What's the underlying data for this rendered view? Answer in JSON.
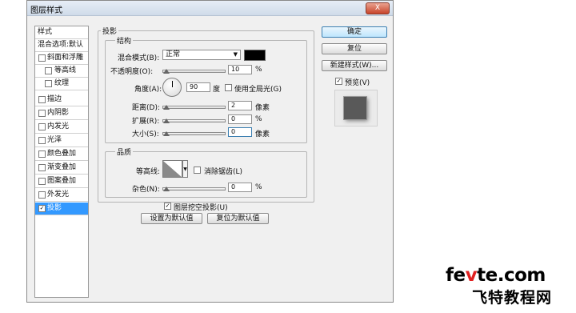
{
  "window": {
    "title": "图层样式",
    "close_label": "X"
  },
  "sidebar": {
    "items": [
      {
        "label": "样式",
        "checkbox": false,
        "checked": false
      },
      {
        "label": "混合选项:默认",
        "checkbox": false,
        "checked": false
      },
      {
        "label": "斜面和浮雕",
        "checkbox": true,
        "checked": false
      },
      {
        "label": "等高线",
        "checkbox": true,
        "checked": false,
        "indent": true
      },
      {
        "label": "纹理",
        "checkbox": true,
        "checked": false,
        "indent": true
      },
      {
        "label": "描边",
        "checkbox": true,
        "checked": false
      },
      {
        "label": "内阴影",
        "checkbox": true,
        "checked": false
      },
      {
        "label": "内发光",
        "checkbox": true,
        "checked": false
      },
      {
        "label": "光泽",
        "checkbox": true,
        "checked": false
      },
      {
        "label": "颜色叠加",
        "checkbox": true,
        "checked": false
      },
      {
        "label": "渐变叠加",
        "checkbox": true,
        "checked": false
      },
      {
        "label": "图案叠加",
        "checkbox": true,
        "checked": false
      },
      {
        "label": "外发光",
        "checkbox": true,
        "checked": false
      },
      {
        "label": "投影",
        "checkbox": true,
        "checked": true,
        "selected": true
      }
    ]
  },
  "panel": {
    "title": "投影",
    "structure": {
      "title": "结构",
      "blend_mode_label": "混合模式(B):",
      "blend_mode_value": "正常",
      "blend_color": "#000000",
      "opacity_label": "不透明度(O):",
      "opacity_value": "10",
      "opacity_unit": "%",
      "angle_label": "角度(A):",
      "angle_value": "90",
      "angle_unit": "度",
      "global_light_label": "使用全局光(G)",
      "global_light_checked": false,
      "distance_label": "距离(D):",
      "distance_value": "2",
      "distance_unit": "像素",
      "spread_label": "扩展(R):",
      "spread_value": "0",
      "spread_unit": "%",
      "size_label": "大小(S):",
      "size_value": "0",
      "size_unit": "像素"
    },
    "quality": {
      "title": "品质",
      "contour_label": "等高线:",
      "antialias_label": "消除锯齿(L)",
      "antialias_checked": false,
      "noise_label": "杂色(N):",
      "noise_value": "0",
      "noise_unit": "%"
    },
    "knockout_label": "图层挖空投影(U)",
    "knockout_checked": true,
    "make_default_label": "设置为默认值",
    "reset_default_label": "复位为默认值"
  },
  "buttons": {
    "ok": "确定",
    "reset": "复位",
    "new_style": "新建样式(W)...",
    "preview_label": "预览(V)",
    "preview_checked": true
  },
  "watermark": {
    "line1_a": "fe",
    "line1_b": "v",
    "line1_c": "te.com",
    "line2": "飞特教程网"
  }
}
